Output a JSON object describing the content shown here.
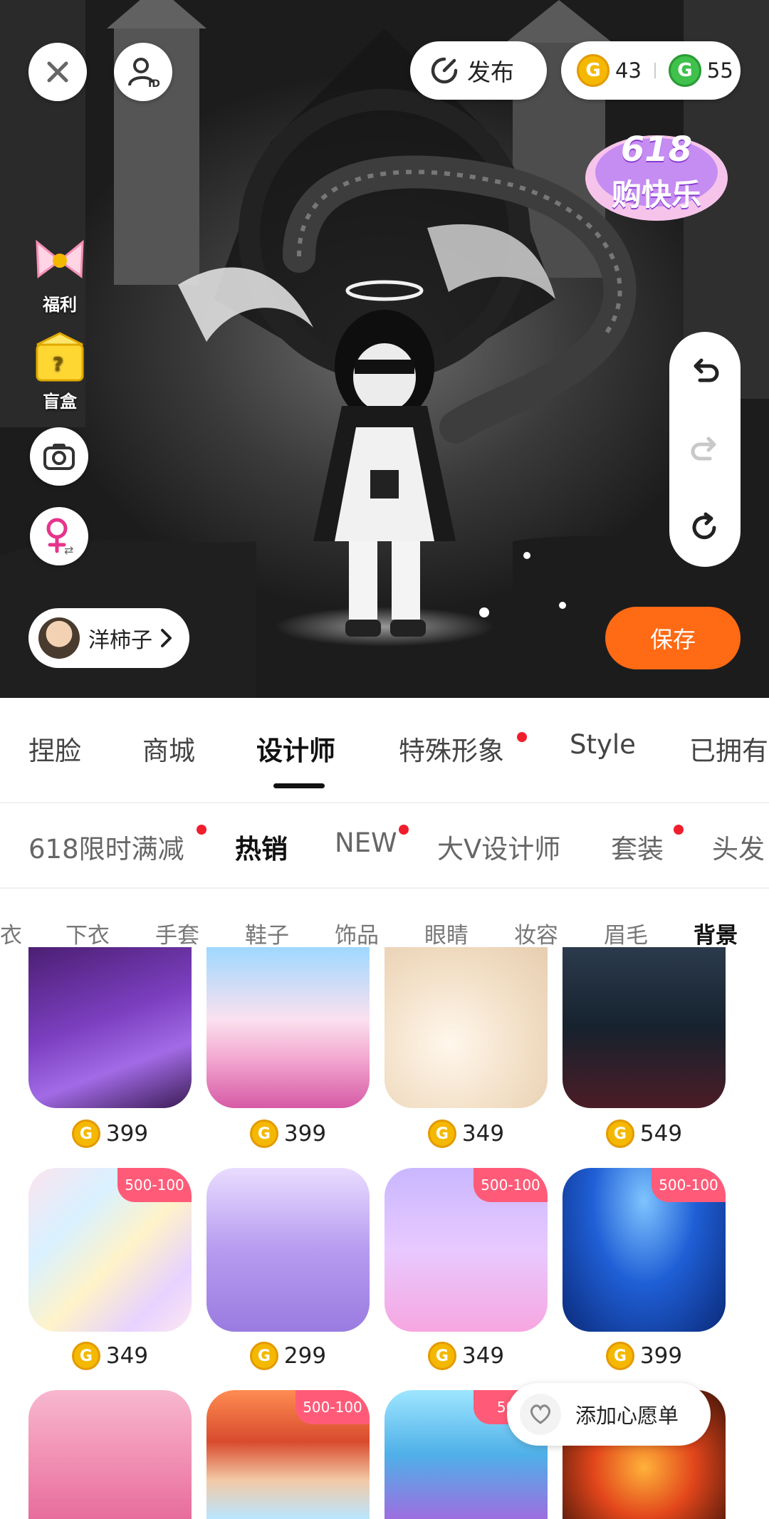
{
  "header": {
    "publish_label": "发布",
    "gold_coins": "43",
    "green_coins": "55",
    "promo_badge_line1": "618",
    "promo_badge_line2": "购快乐"
  },
  "side": {
    "welfare_label": "福利",
    "blindbox_label": "盲盒"
  },
  "user": {
    "name": "洋柿子"
  },
  "save_label": "保存",
  "tabs_main": [
    {
      "label": "捏脸",
      "active": false,
      "dot": false
    },
    {
      "label": "商城",
      "active": false,
      "dot": false
    },
    {
      "label": "设计师",
      "active": true,
      "dot": false
    },
    {
      "label": "特殊形象",
      "active": false,
      "dot": true
    },
    {
      "label": "Style",
      "active": false,
      "dot": false
    },
    {
      "label": "已拥有",
      "active": false,
      "dot": false
    }
  ],
  "tabs_sub": [
    {
      "label": "618限时满减",
      "active": false,
      "dot": true
    },
    {
      "label": "热销",
      "active": true,
      "dot": false
    },
    {
      "label": "NEW",
      "active": false,
      "dot": true
    },
    {
      "label": "大V设计师",
      "active": false,
      "dot": false
    },
    {
      "label": "套装",
      "active": false,
      "dot": true
    },
    {
      "label": "头发",
      "active": false,
      "dot": false
    }
  ],
  "tabs_category": [
    {
      "label": "衣",
      "active": false
    },
    {
      "label": "下衣",
      "active": false
    },
    {
      "label": "手套",
      "active": false
    },
    {
      "label": "鞋子",
      "active": false
    },
    {
      "label": "饰品",
      "active": false
    },
    {
      "label": "眼睛",
      "active": false
    },
    {
      "label": "妆容",
      "active": false
    },
    {
      "label": "眉毛",
      "active": false
    },
    {
      "label": "背景",
      "active": true
    }
  ],
  "items": [
    {
      "price": "399",
      "badge": "",
      "theme": "gaming-room"
    },
    {
      "price": "399",
      "badge": "",
      "theme": "pink-castle"
    },
    {
      "price": "349",
      "badge": "",
      "theme": "cream-fur"
    },
    {
      "price": "549",
      "badge": "",
      "theme": "sports-car"
    },
    {
      "price": "349",
      "badge": "500-100",
      "theme": "holographic-marble"
    },
    {
      "price": "299",
      "badge": "",
      "theme": "lavender-stairs"
    },
    {
      "price": "349",
      "badge": "500-100",
      "theme": "purple-bedroom"
    },
    {
      "price": "399",
      "badge": "500-100",
      "theme": "blue-stage"
    },
    {
      "price": "",
      "badge": "",
      "theme": "pink-room"
    },
    {
      "price": "",
      "badge": "500-100",
      "theme": "lantern-street"
    },
    {
      "price": "",
      "badge": "500",
      "theme": "undersea-shell"
    },
    {
      "price": "",
      "badge": "",
      "theme": "lava"
    }
  ],
  "wishlist_label": "添加心愿单",
  "colors": {
    "accent": "#ff6a14",
    "badge": "#ff5b78",
    "dot": "#f01e2c",
    "coin": "#f5b800"
  }
}
